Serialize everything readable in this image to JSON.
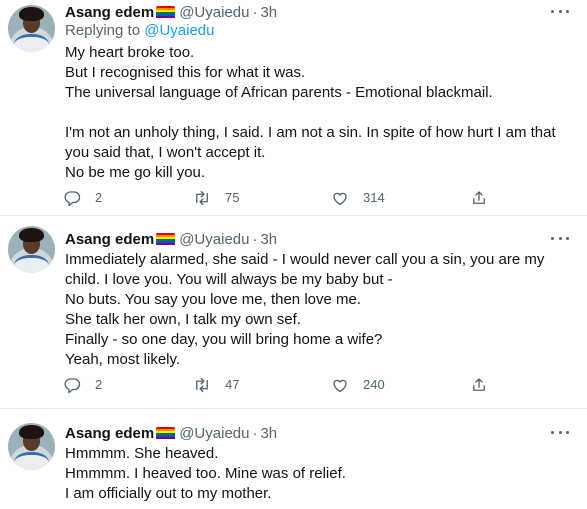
{
  "tweets": [
    {
      "author_name": "Asang edem",
      "handle": "@Uyaiedu",
      "separator": "·",
      "time": "3h",
      "replying_label": "Replying to",
      "replying_handle": "@Uyaiedu",
      "text": "My heart broke too.\nBut I recognised this for what it was.\nThe universal language of African parents - Emotional blackmail.\n\nI'm not an unholy thing, I said. I am not a sin. In spite of how hurt I am that\nyou said that, I won't accept it.\nNo be me go kill you.",
      "replies": "2",
      "retweets": "75",
      "likes": "314"
    },
    {
      "author_name": "Asang edem",
      "handle": "@Uyaiedu",
      "separator": "·",
      "time": "3h",
      "text": "Immediately alarmed, she said - I would never call you a sin, you are my\nchild. I love you. You will always be my baby but -\nNo buts. You say you love me, then love me.\nShe talk her own, I talk my own sef.\nFinally - so one day, you will bring home a wife?\nYeah, most likely.",
      "replies": "2",
      "retweets": "47",
      "likes": "240"
    },
    {
      "author_name": "Asang edem",
      "handle": "@Uyaiedu",
      "separator": "·",
      "time": "3h",
      "text": "Hmmmm. She heaved.\nHmmmm. I heaved too. Mine was of relief.\nI am officially out to my mother."
    }
  ],
  "icons": {
    "reply": "reply-icon",
    "retweet": "retweet-icon",
    "like": "heart-icon",
    "share": "share-icon",
    "more": "more-icon",
    "flag": "rainbow-flag-icon"
  },
  "colors": {
    "text": "#0f1419",
    "secondary": "#536471",
    "link": "#1d9bf0",
    "divider": "#e6ecf0"
  }
}
